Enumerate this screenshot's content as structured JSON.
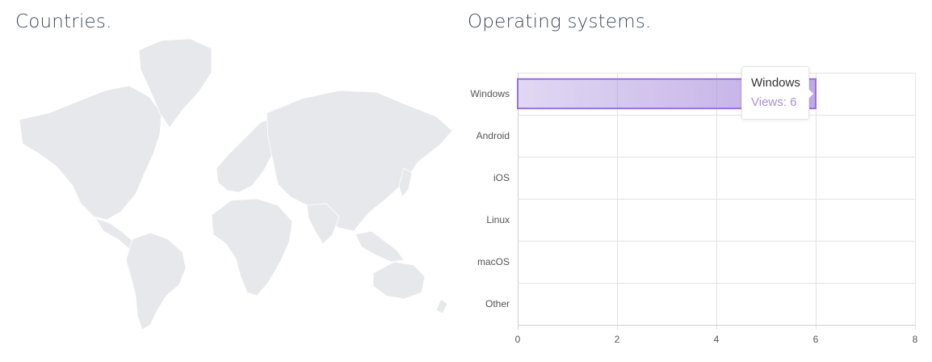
{
  "countries": {
    "title": "Countries."
  },
  "operating_systems": {
    "title": "Operating systems."
  },
  "chart_data": {
    "type": "bar",
    "orientation": "horizontal",
    "categories": [
      "Windows",
      "Android",
      "iOS",
      "Linux",
      "macOS",
      "Other"
    ],
    "series": [
      {
        "values": [
          6,
          0,
          0,
          0,
          0,
          0
        ]
      }
    ],
    "xlim": [
      0,
      8
    ],
    "xticks": [
      0,
      2,
      4,
      6,
      8
    ],
    "grid": true,
    "bar_color": "#a98fdc"
  },
  "tooltip": {
    "title": "Windows",
    "value": "Views: 6"
  }
}
